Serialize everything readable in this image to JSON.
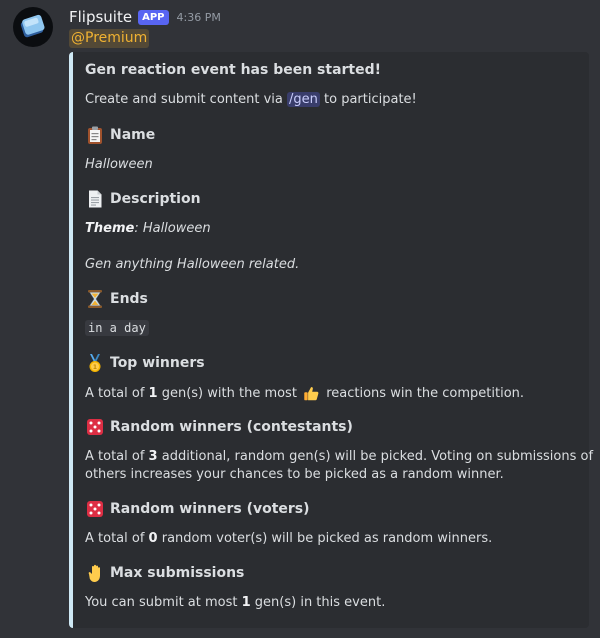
{
  "message": {
    "username": "Flipsuite",
    "badge": "APP",
    "timestamp": "4:36 PM",
    "mention": "@Premium"
  },
  "embed": {
    "title": "Gen reaction event has been started!",
    "intro_before": "Create and submit content via ",
    "intro_command": "/gen",
    "intro_after": " to participate!",
    "fields": {
      "name": {
        "icon": "clipboard-icon",
        "label": "Name",
        "value": "Halloween"
      },
      "description": {
        "icon": "page-icon",
        "label": "Description",
        "theme_label": "Theme",
        "theme_value": ": Halloween",
        "text": "Gen anything Halloween related."
      },
      "ends": {
        "icon": "hourglass-icon",
        "label": "Ends",
        "value": "in a day"
      },
      "top_winners": {
        "icon": "medal-icon",
        "label": "Top winners",
        "text_before": "A total of ",
        "count": "1",
        "text_middle": " gen(s) with the most ",
        "reaction_icon": "thumbs-up-icon",
        "text_after": " reactions win the competition."
      },
      "random_contestants": {
        "icon": "dice-icon",
        "label": "Random winners (contestants)",
        "text_before": "A total of ",
        "count": "3",
        "text_after_line1": " additional, random gen(s) will be picked. Voting on submissions of",
        "text_line2": "others increases your chances to be picked as a random winner."
      },
      "random_voters": {
        "icon": "dice-icon",
        "label": "Random winners (voters)",
        "text_before": "A total of ",
        "count": "0",
        "text_after": " random voter(s) will be picked as random winners."
      },
      "max_submissions": {
        "icon": "hand-icon",
        "label": "Max submissions",
        "text_before": "You can submit at most ",
        "count": "1",
        "text_after": " gen(s) in this event."
      }
    }
  },
  "colors": {
    "background": "#313338",
    "embed_background": "#2b2d31",
    "embed_border": "#cfe9f5",
    "app_badge": "#5865f2",
    "mention": "#f0b232"
  }
}
